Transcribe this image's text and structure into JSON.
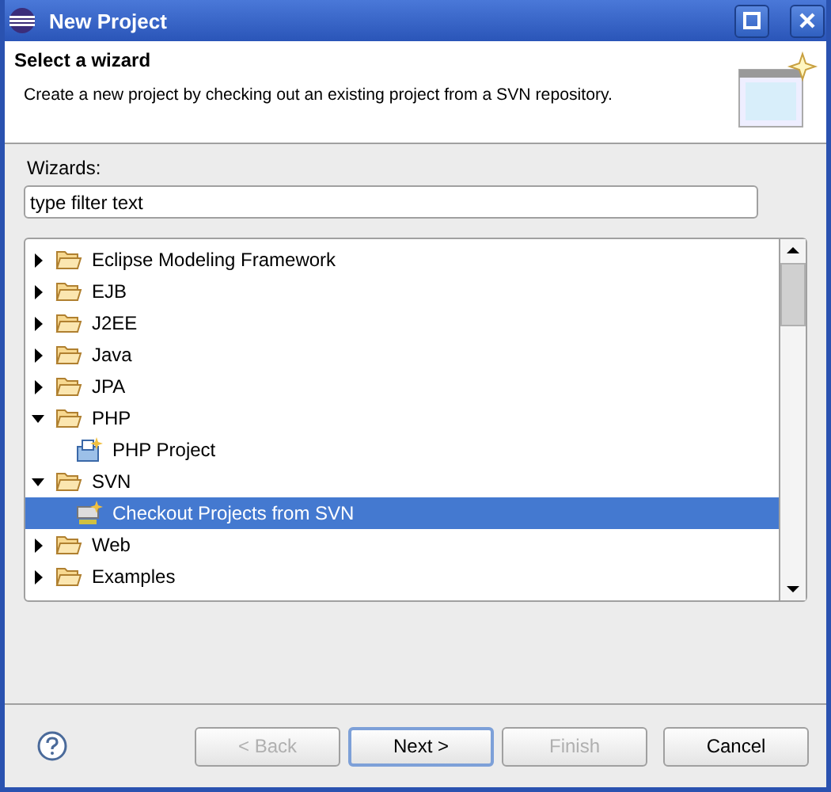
{
  "window": {
    "title": "New Project"
  },
  "header": {
    "title": "Select a wizard",
    "description": "Create a new project by checking out an existing project from a SVN repository."
  },
  "wizards_label": "Wizards:",
  "filter": {
    "value": "type filter text"
  },
  "tree": [
    {
      "label": "Eclipse Modeling Framework",
      "kind": "folder",
      "expanded": false,
      "selected": false
    },
    {
      "label": "EJB",
      "kind": "folder",
      "expanded": false,
      "selected": false
    },
    {
      "label": "J2EE",
      "kind": "folder",
      "expanded": false,
      "selected": false
    },
    {
      "label": "Java",
      "kind": "folder",
      "expanded": false,
      "selected": false
    },
    {
      "label": "JPA",
      "kind": "folder",
      "expanded": false,
      "selected": false
    },
    {
      "label": "PHP",
      "kind": "folder",
      "expanded": true,
      "selected": false,
      "children": [
        {
          "label": "PHP Project",
          "kind": "php-wizard",
          "selected": false
        }
      ]
    },
    {
      "label": "SVN",
      "kind": "folder",
      "expanded": true,
      "selected": false,
      "children": [
        {
          "label": "Checkout Projects from SVN",
          "kind": "svn-wizard",
          "selected": true
        }
      ]
    },
    {
      "label": "Web",
      "kind": "folder",
      "expanded": false,
      "selected": false
    },
    {
      "label": "Examples",
      "kind": "folder",
      "expanded": false,
      "selected": false
    }
  ],
  "buttons": [
    {
      "label": "< Back",
      "disabled": true,
      "default": false
    },
    {
      "label": "Next >",
      "disabled": false,
      "default": true
    },
    {
      "label": "Finish",
      "disabled": true,
      "default": false
    },
    {
      "label": "Cancel",
      "disabled": false,
      "default": false
    }
  ]
}
